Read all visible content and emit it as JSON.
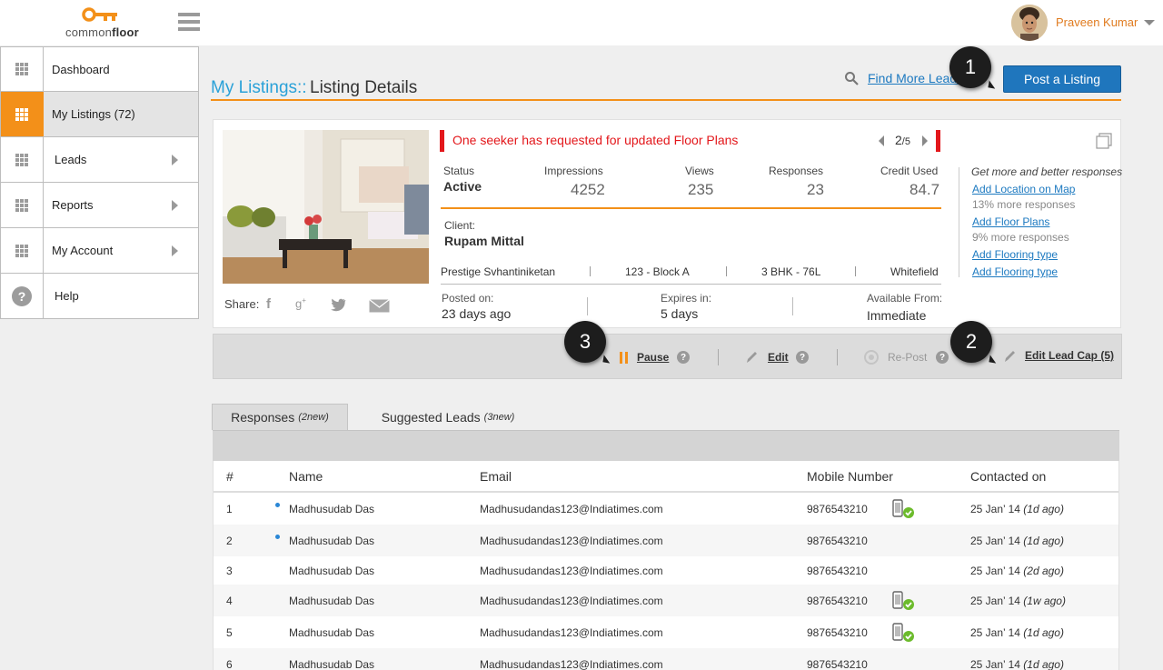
{
  "header": {
    "logo_text_a": "common",
    "logo_text_b": "floor",
    "user_name": "Praveen Kumar"
  },
  "sidebar": {
    "items": [
      {
        "label": "Dashboard"
      },
      {
        "label": "My Listings (72)"
      },
      {
        "label": "Leads"
      },
      {
        "label": "Reports"
      },
      {
        "label": "My Account"
      },
      {
        "label": "Help"
      }
    ]
  },
  "page": {
    "breadcrumb_section": "My Listings::",
    "breadcrumb_current": "Listing Details",
    "find_link": "Find More Leads",
    "post_button": "Post a Listing",
    "callouts": [
      "1",
      "2",
      "3"
    ]
  },
  "listing": {
    "alert": "One seeker has requested for updated Floor Plans",
    "pager_current": "2",
    "pager_total": "/5",
    "share_label": "Share:",
    "stats": {
      "status_label": "Status",
      "status_value": "Active",
      "impressions_label": "Impressions",
      "impressions_value": "4252",
      "views_label": "Views",
      "views_value": "235",
      "responses_label": "Responses",
      "responses_value": "23",
      "credit_label": "Credit Used",
      "credit_value": "84.7"
    },
    "client_label": "Client:",
    "client_value": "Rupam Mittal",
    "meta": {
      "project": "Prestige Svhantiniketan",
      "unit": "123 - Block A",
      "config": "3 BHK - 76L",
      "locality": "Whitefield"
    },
    "dates": {
      "posted_label": "Posted on:",
      "posted_value": "23 days ago",
      "expires_label": "Expires in:",
      "expires_value": "5 days",
      "available_label": "Available From:",
      "available_value": "Immediate"
    },
    "tips": {
      "heading": "Get more and better responses",
      "links": [
        {
          "label": "Add Location on Map",
          "sub": "13% more responses"
        },
        {
          "label": "Add Floor Plans",
          "sub": "9% more responses"
        },
        {
          "label": "Add Flooring type"
        },
        {
          "label": "Add Flooring type"
        }
      ]
    }
  },
  "actions": {
    "pause": "Pause",
    "edit": "Edit",
    "repost": "Re-Post",
    "edit_lead_cap": "Edit Lead Cap (5)",
    "help_glyph": "?"
  },
  "tabs": [
    {
      "label": "Responses",
      "badge": "(2new)"
    },
    {
      "label": "Suggested Leads",
      "badge": "(3new)"
    }
  ],
  "table": {
    "columns": [
      "#",
      "Name",
      "Email",
      "Mobile Number",
      "Contacted on"
    ],
    "rows": [
      {
        "n": "1",
        "name": "Madhusudab Das",
        "email": "Madhusudandas123@Indiatimes.com",
        "mobile": "9876543210",
        "date": "25 Jan’ 14",
        "ago": "(1d ago)",
        "new": true,
        "verified": true
      },
      {
        "n": "2",
        "name": "Madhusudab Das",
        "email": "Madhusudandas123@Indiatimes.com",
        "mobile": "9876543210",
        "date": "25 Jan’ 14",
        "ago": "(1d ago)",
        "new": true,
        "verified": false
      },
      {
        "n": "3",
        "name": "Madhusudab Das",
        "email": "Madhusudandas123@Indiatimes.com",
        "mobile": "9876543210",
        "date": "25 Jan’ 14",
        "ago": "(2d ago)",
        "new": false,
        "verified": false
      },
      {
        "n": "4",
        "name": "Madhusudab Das",
        "email": "Madhusudandas123@Indiatimes.com",
        "mobile": "9876543210",
        "date": "25 Jan’ 14",
        "ago": "(1w ago)",
        "new": false,
        "verified": true
      },
      {
        "n": "5",
        "name": "Madhusudab Das",
        "email": "Madhusudandas123@Indiatimes.com",
        "mobile": "9876543210",
        "date": "25 Jan’ 14",
        "ago": "(1d ago)",
        "new": false,
        "verified": true
      },
      {
        "n": "6",
        "name": "Madhusudab Das",
        "email": "Madhusudandas123@Indiatimes.com",
        "mobile": "9876543210",
        "date": "25 Jan’ 14",
        "ago": "(1d ago)",
        "new": false,
        "verified": false
      }
    ]
  },
  "colors": {
    "accent": "#f39019",
    "link": "#1c79c0",
    "primary_button": "#1f76bd",
    "alert": "#e3171b",
    "breadcrumb": "#2aa1d8"
  }
}
